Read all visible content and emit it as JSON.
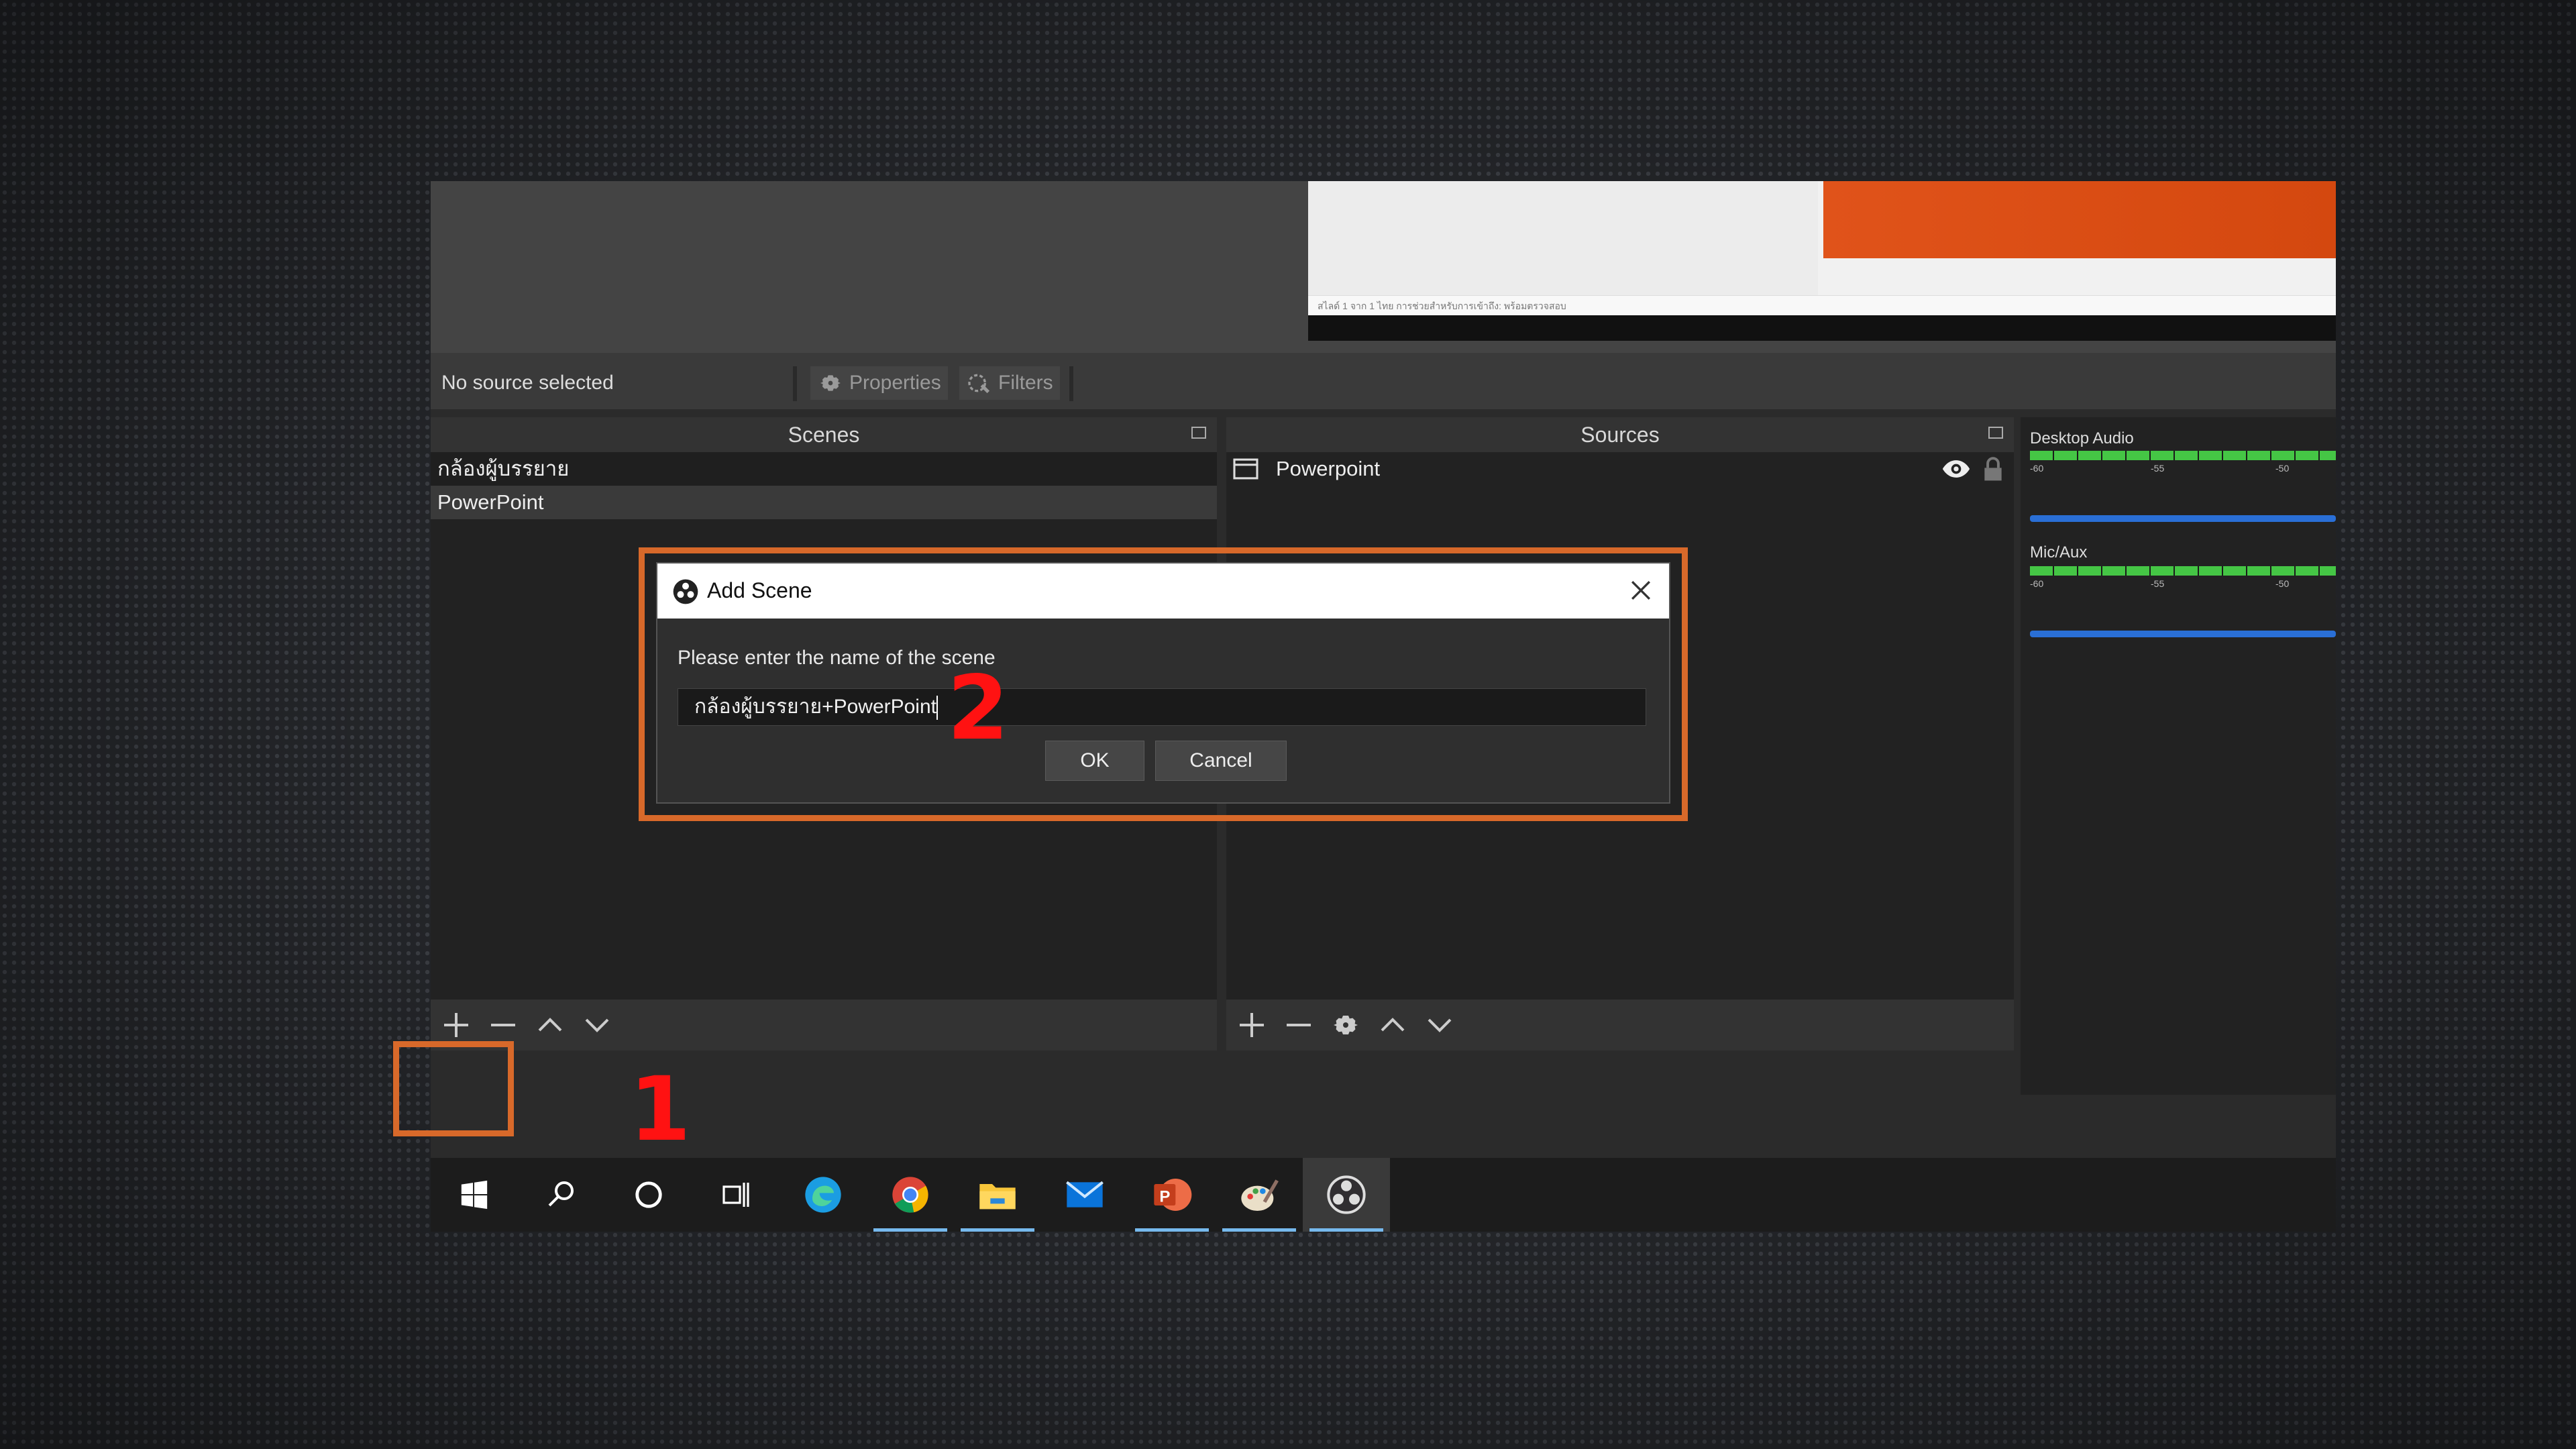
{
  "source_bar": {
    "no_source": "No source selected",
    "properties": "Properties",
    "filters": "Filters"
  },
  "preview": {
    "status_text": "สไลด์ 1 จาก 1   ไทย   การช่วยสำหรับการเข้าถึง: พร้อมตรวจสอบ"
  },
  "scenes": {
    "title": "Scenes",
    "items": [
      "กล้องผู้บรรยาย",
      "PowerPoint"
    ]
  },
  "sources": {
    "title": "Sources",
    "items": [
      {
        "name": "Powerpoint"
      }
    ]
  },
  "mixer": {
    "desktop_audio": {
      "label": "Desktop Audio",
      "ticks": [
        "-60",
        "-55",
        "-50"
      ]
    },
    "mic_aux": {
      "label": "Mic/Aux",
      "ticks": [
        "-60",
        "-55",
        "-50"
      ]
    }
  },
  "dialog": {
    "title": "Add Scene",
    "prompt": "Please enter the name of the scene",
    "input_value": "กล้องผู้บรรยาย+PowerPoint",
    "ok_label": "OK",
    "cancel_label": "Cancel"
  },
  "annotations": {
    "step1": "1",
    "step2": "2"
  },
  "colors": {
    "callout_orange": "#d8692a",
    "step_red": "#ff1212",
    "meter_green": "#45c645",
    "volume_blue": "#2a6fd6"
  },
  "taskbar": {
    "icons": [
      "windows-start-icon",
      "search-icon",
      "cortana-icon",
      "task-view-icon",
      "edge-icon",
      "chrome-icon",
      "file-explorer-icon",
      "mail-icon",
      "powerpoint-icon",
      "paint-icon",
      "obs-icon"
    ]
  }
}
